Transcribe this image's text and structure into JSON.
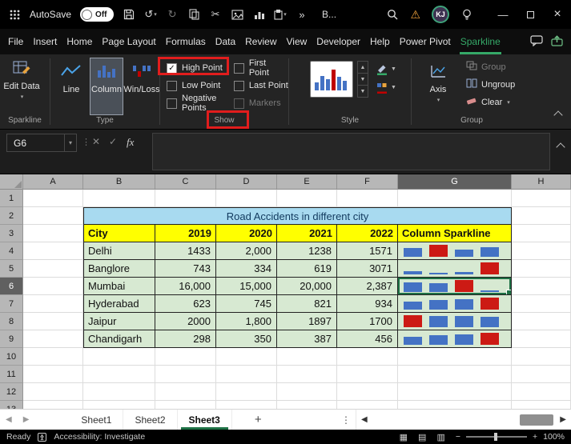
{
  "colors": {
    "accent_green": "#35a968",
    "spark_bar": "#4472c4",
    "spark_high": "#cc1a14",
    "title_fill": "#a8daf0",
    "header_fill": "#ffff00",
    "data_fill": "#d7e9d2",
    "annotation_red": "#e11d1d"
  },
  "title_bar": {
    "autosave_label": "AutoSave",
    "autosave_state": "Off",
    "doc_title": "B...",
    "user_initials": "KJ",
    "more_chevron": "»"
  },
  "menu_bar": {
    "items": [
      "File",
      "Insert",
      "Home",
      "Page Layout",
      "Formulas",
      "Data",
      "Review",
      "View",
      "Developer",
      "Help",
      "Power Pivot",
      "Sparkline"
    ],
    "active_item": "Sparkline"
  },
  "ribbon": {
    "edit_data_label": "Edit Data",
    "type_buttons": [
      {
        "label": "Line",
        "selected": false
      },
      {
        "label": "Column",
        "selected": true
      },
      {
        "label": "Win/Loss",
        "selected": false
      }
    ],
    "show_checkboxes": [
      {
        "label": "High Point",
        "checked": true,
        "disabled": false
      },
      {
        "label": "Low Point",
        "checked": false,
        "disabled": false
      },
      {
        "label": "Negative Points",
        "checked": false,
        "disabled": false
      },
      {
        "label": "First Point",
        "checked": false,
        "disabled": false
      },
      {
        "label": "Last Point",
        "checked": false,
        "disabled": false
      },
      {
        "label": "Markers",
        "checked": false,
        "disabled": true
      }
    ],
    "axis_label": "Axis",
    "group_items": [
      {
        "label": "Group",
        "disabled": true
      },
      {
        "label": "Ungroup",
        "disabled": false
      },
      {
        "label": "Clear",
        "disabled": false
      }
    ],
    "group_labels": {
      "sparkline": "Sparkline",
      "type": "Type",
      "show": "Show",
      "style": "Style",
      "group": "Group"
    }
  },
  "formula_bar": {
    "name_box_value": "G6",
    "fx_label": "fx",
    "formula_value": ""
  },
  "grid": {
    "column_headers": [
      "A",
      "B",
      "C",
      "D",
      "E",
      "F",
      "G",
      "H"
    ],
    "selected_column": "G",
    "row_count": 13,
    "selected_row": 6,
    "active_cell": "G6",
    "title_cell_text": "Road Accidents in different city",
    "table_headers": [
      "City",
      "2019",
      "2020",
      "2021",
      "2022",
      "Column Sparkline"
    ],
    "rows": [
      {
        "city": "Delhi",
        "display": [
          "1433",
          "2,000",
          "1238",
          "1571"
        ],
        "values": [
          1433,
          2000,
          1238,
          1571
        ]
      },
      {
        "city": "Banglore",
        "display": [
          "743",
          "334",
          "619",
          "3071"
        ],
        "values": [
          743,
          334,
          619,
          3071
        ]
      },
      {
        "city": "Mumbai",
        "display": [
          "16,000",
          "15,000",
          "20,000",
          "2,387"
        ],
        "values": [
          16000,
          15000,
          20000,
          2387
        ]
      },
      {
        "city": "Hyderabad",
        "display": [
          "623",
          "745",
          "821",
          "934"
        ],
        "values": [
          623,
          745,
          821,
          934
        ]
      },
      {
        "city": "Jaipur",
        "display": [
          "2000",
          "1,800",
          "1897",
          "1700"
        ],
        "values": [
          2000,
          1800,
          1897,
          1700
        ]
      },
      {
        "city": "Chandigarh",
        "display": [
          "298",
          "350",
          "387",
          "456"
        ],
        "values": [
          298,
          350,
          387,
          456
        ]
      }
    ]
  },
  "sheet_tabs": {
    "tabs": [
      "Sheet1",
      "Sheet2",
      "Sheet3"
    ],
    "active_tab": "Sheet3"
  },
  "status_bar": {
    "ready_label": "Ready",
    "accessibility_label": "Accessibility: Investigate",
    "zoom_level": "100%"
  }
}
